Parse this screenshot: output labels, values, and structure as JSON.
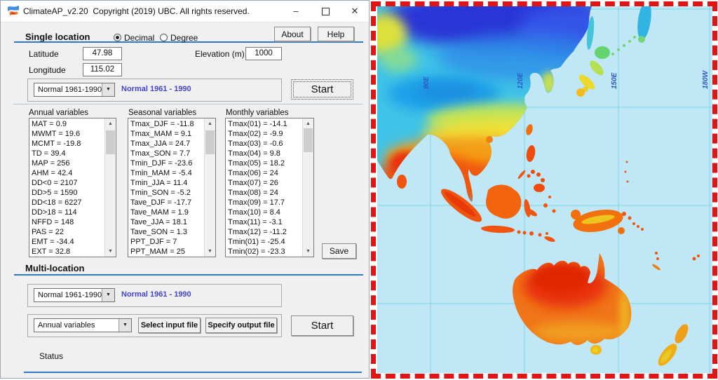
{
  "window": {
    "title": "ClimateAP_v2.20  Copyright (2019) UBC. All rights reserved.",
    "controls": {
      "minimize": "–",
      "close": "✕"
    }
  },
  "icons": {
    "dropdown_arrow": "▼",
    "scroll_up": "▲",
    "scroll_down": "▼"
  },
  "single_location": {
    "heading": "Single location",
    "radio_decimal_label": "Decimal",
    "radio_degree_label": "Degree",
    "about_label": "About",
    "help_label": "Help",
    "latitude_label": "Latitude",
    "latitude_value": "47.98",
    "longitude_label": "Longitude",
    "longitude_value": "115.02",
    "elevation_label": "Elevation (m)",
    "elevation_value": "1000",
    "period_dropdown_value": "Normal 1961-1990",
    "period_info": "Normal 1961 - 1990",
    "start_label": "Start"
  },
  "variables": {
    "annual": {
      "label": "Annual variables",
      "items": [
        "MAT = 0.9",
        "MWMT = 19.6",
        "MCMT = -19.8",
        "TD = 39.4",
        "MAP = 256",
        "AHM = 42.4",
        "DD<0 = 2107",
        "DD>5 = 1590",
        "DD<18 = 6227",
        "DD>18 = 114",
        "NFFD = 148",
        "PAS = 22",
        "EMT = -34.4",
        "EXT = 32.8"
      ]
    },
    "seasonal": {
      "label": "Seasonal variables",
      "items": [
        "Tmax_DJF = -11.8",
        "Tmax_MAM = 9.1",
        "Tmax_JJA = 24.7",
        "Tmax_SON = 7.7",
        "Tmin_DJF = -23.6",
        "Tmin_MAM = -5.4",
        "Tmin_JJA = 11.4",
        "Tmin_SON = -5.2",
        "Tave_DJF = -17.7",
        "Tave_MAM = 1.9",
        "Tave_JJA = 18.1",
        "Tave_SON = 1.3",
        "PPT_DJF = 7",
        "PPT_MAM = 25"
      ]
    },
    "monthly": {
      "label": "Monthly variables",
      "items": [
        "Tmax(01) = -14.1",
        "Tmax(02) = -9.9",
        "Tmax(03) = -0.6",
        "Tmax(04) = 9.8",
        "Tmax(05) = 18.2",
        "Tmax(06) = 24",
        "Tmax(07) = 26",
        "Tmax(08) = 24",
        "Tmax(09) = 17.7",
        "Tmax(10) = 8.4",
        "Tmax(11) = -3.1",
        "Tmax(12) = -11.2",
        "Tmin(01) = -25.4",
        "Tmin(02) = -23.3"
      ]
    },
    "save_label": "Save"
  },
  "multi_location": {
    "heading": "Multi-location",
    "period_dropdown_value": "Normal 1961-1990",
    "period_info": "Normal 1961 - 1990",
    "variables_dropdown_value": "Annual variables",
    "select_input_label": "Select input file",
    "specify_output_label": "Specify output file",
    "start_label": "Start",
    "status_label": "Status"
  },
  "map": {
    "graticule_labels": [
      "90E",
      "120E",
      "150E",
      "180W"
    ],
    "colors": {
      "ocean": "#bfe7f5",
      "grid": "#7fd4e8",
      "border_red": "#e01414",
      "label_blue": "#3058c8",
      "ramp_cold": "#2b36d6",
      "ramp_cool": "#2f8ae8",
      "ramp_mid": "#3fc3e8",
      "ramp_warm": "#f0e038",
      "ramp_hot": "#f0560e",
      "ramp_hottest": "#e8320a"
    }
  }
}
